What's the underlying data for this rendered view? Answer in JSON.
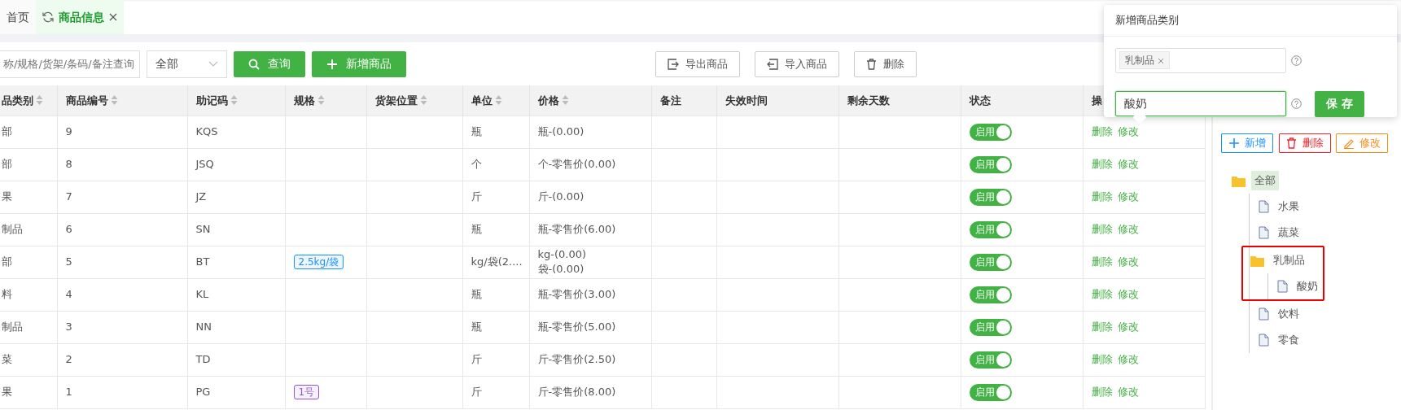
{
  "tabs": [
    {
      "label": "首页",
      "selected": false,
      "refresh": false,
      "closable": false
    },
    {
      "label": "商品信息",
      "selected": true,
      "refresh": true,
      "closable": true
    }
  ],
  "toolbar": {
    "search": {
      "placeholder": "称/规格/货架/条码/备注查询"
    },
    "filter": {
      "value": "全部"
    },
    "buttons": [
      {
        "label": "查询",
        "kind": "search"
      },
      {
        "label": "新增商品",
        "kind": "add"
      }
    ],
    "right_buttons": [
      {
        "label": "导出商品",
        "kind": "export"
      },
      {
        "label": "导入商品",
        "kind": "import"
      },
      {
        "label": "删除",
        "kind": "delete"
      }
    ]
  },
  "table": {
    "columns": [
      {
        "label": "品类别",
        "sortable": true
      },
      {
        "label": "商品编号",
        "sortable": true
      },
      {
        "label": "助记码",
        "sortable": true
      },
      {
        "label": "规格",
        "sortable": true
      },
      {
        "label": "货架位置",
        "sortable": true
      },
      {
        "label": "单位",
        "sortable": true
      },
      {
        "label": "价格",
        "sortable": true
      },
      {
        "label": "备注",
        "sortable": false
      },
      {
        "label": "失效时间",
        "sortable": false
      },
      {
        "label": "剩余天数",
        "sortable": false
      },
      {
        "label": "状态",
        "sortable": false
      },
      {
        "label": "操"
      }
    ],
    "rows": [
      {
        "category": "部",
        "code": "9",
        "mnemonic": "KQS",
        "unit": "瓶",
        "prices": [
          "瓶-(0.00)"
        ],
        "status": {
          "label": "启用",
          "on": true
        },
        "actions": [
          "删除",
          "修改"
        ]
      },
      {
        "category": "部",
        "code": "8",
        "mnemonic": "JSQ",
        "unit": "个",
        "prices": [
          "个-零售价(0.00)"
        ],
        "status": {
          "label": "启用",
          "on": true
        },
        "actions": [
          "删除",
          "修改"
        ]
      },
      {
        "category": "果",
        "code": "7",
        "mnemonic": "JZ",
        "unit": "斤",
        "prices": [
          "斤-(0.00)"
        ],
        "status": {
          "label": "启用",
          "on": true
        },
        "actions": [
          "删除",
          "修改"
        ]
      },
      {
        "category": "制品",
        "code": "6",
        "mnemonic": "SN",
        "unit": "瓶",
        "prices": [
          "瓶-零售价(6.00)"
        ],
        "status": {
          "label": "启用",
          "on": true
        },
        "actions": [
          "删除",
          "修改"
        ]
      },
      {
        "category": "部",
        "code": "5",
        "mnemonic": "BT",
        "spec": {
          "text": "2.5kg/袋",
          "color": "#1890ff"
        },
        "unit": "kg/袋(2....",
        "prices": [
          "kg-(0.00)",
          "袋-(0.00)"
        ],
        "status": {
          "label": "启用",
          "on": true
        },
        "actions": [
          "删除",
          "修改"
        ]
      },
      {
        "category": "料",
        "code": "4",
        "mnemonic": "KL",
        "unit": "瓶",
        "prices": [
          "瓶-零售价(3.00)"
        ],
        "status": {
          "label": "启用",
          "on": true
        },
        "actions": [
          "删除",
          "修改"
        ]
      },
      {
        "category": "制品",
        "code": "3",
        "mnemonic": "NN",
        "unit": "瓶",
        "prices": [
          "瓶-零售价(5.00)"
        ],
        "status": {
          "label": "启用",
          "on": true
        },
        "actions": [
          "删除",
          "修改"
        ]
      },
      {
        "category": "菜",
        "code": "2",
        "mnemonic": "TD",
        "unit": "斤",
        "prices": [
          "斤-零售价(2.50)"
        ],
        "status": {
          "label": "启用",
          "on": true
        },
        "actions": [
          "删除",
          "修改"
        ]
      },
      {
        "category": "果",
        "code": "1",
        "mnemonic": "PG",
        "spec": {
          "text": "1号",
          "color": "#9254de"
        },
        "unit": "斤",
        "prices": [
          "斤-零售价(8.00)"
        ],
        "status": {
          "label": "启用",
          "on": true
        },
        "actions": [
          "删除",
          "修改"
        ]
      }
    ]
  },
  "popup": {
    "title": "新增商品类别",
    "parent_tag": "乳制品",
    "name_value": "酸奶",
    "save": "保 存"
  },
  "panel": {
    "buttons": [
      {
        "label": "新增",
        "kind": "add"
      },
      {
        "label": "删除",
        "kind": "delete"
      },
      {
        "label": "修改",
        "kind": "edit"
      }
    ],
    "tree": [
      {
        "label": "全部",
        "kind": "folder",
        "selected": true,
        "highlighted": false,
        "children": [
          {
            "label": "水果",
            "kind": "file",
            "selected": false,
            "highlighted": false
          },
          {
            "label": "蔬菜",
            "kind": "file",
            "selected": false,
            "highlighted": false
          },
          {
            "label": "乳制品",
            "kind": "folder",
            "selected": false,
            "highlighted": true,
            "children": [
              {
                "label": "酸奶",
                "kind": "file",
                "selected": false,
                "highlighted": false
              }
            ]
          },
          {
            "label": "饮料",
            "kind": "file",
            "selected": false,
            "highlighted": false
          },
          {
            "label": "零食",
            "kind": "file",
            "selected": false,
            "highlighted": false
          }
        ]
      }
    ]
  }
}
